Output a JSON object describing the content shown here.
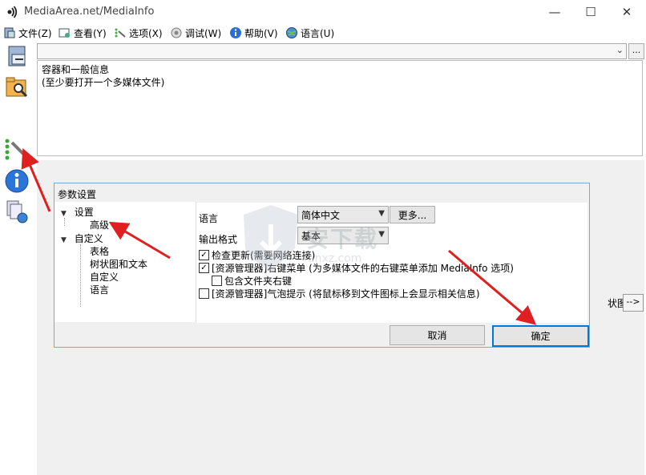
{
  "window": {
    "title": "MediaArea.net/MediaInfo",
    "minimize": "—",
    "maximize": "☐",
    "close": "✕"
  },
  "menu": [
    {
      "label": "文件(Z)",
      "icon": "file-icon"
    },
    {
      "label": "查看(Y)",
      "icon": "view-icon"
    },
    {
      "label": "选项(X)",
      "icon": "options-icon"
    },
    {
      "label": "调试(W)",
      "icon": "debug-icon"
    },
    {
      "label": "帮助(V)",
      "icon": "help-icon"
    },
    {
      "label": "语言(U)",
      "icon": "language-icon"
    }
  ],
  "main": {
    "combo_arrow": "⌄",
    "browse_label": "...",
    "info_line1": "容器和一般信息",
    "info_line2": "(至少要打开一个多媒体文件)",
    "partial_label": "状图 ...)",
    "next_label": "-->"
  },
  "dialog": {
    "title": "参数设置",
    "tree": [
      {
        "label": "设置",
        "level": 0,
        "expanded": true
      },
      {
        "label": "高级",
        "level": 1
      },
      {
        "label": "自定义",
        "level": 0,
        "expanded": true
      },
      {
        "label": "表格",
        "level": 1
      },
      {
        "label": "树状图和文本",
        "level": 1
      },
      {
        "label": "自定义",
        "level": 1
      },
      {
        "label": "语言",
        "level": 1
      }
    ],
    "language_label": "语言",
    "language_value": "简体中文",
    "more_button": "更多...",
    "output_label": "输出格式",
    "output_value": "基本",
    "check_update": "检查更新(需要网络连接)",
    "check_update_checked": true,
    "shell_ext": "[资源管理器]右键菜单 (为多媒体文件的右键菜单添加 MediaInfo 选项)",
    "shell_ext_checked": true,
    "folder_ext": "包含文件夹右键",
    "folder_ext_checked": false,
    "tooltip": "[资源管理器]气泡提示 (将鼠标移到文件图标上会显示相关信息)",
    "tooltip_checked": false,
    "cancel": "取消",
    "ok": "确定",
    "check_mark": "✓"
  },
  "watermark": {
    "text": "安下载",
    "sub": "anxz.com"
  },
  "colors": {
    "arrow": "#e02020",
    "accent": "#0078d7"
  }
}
